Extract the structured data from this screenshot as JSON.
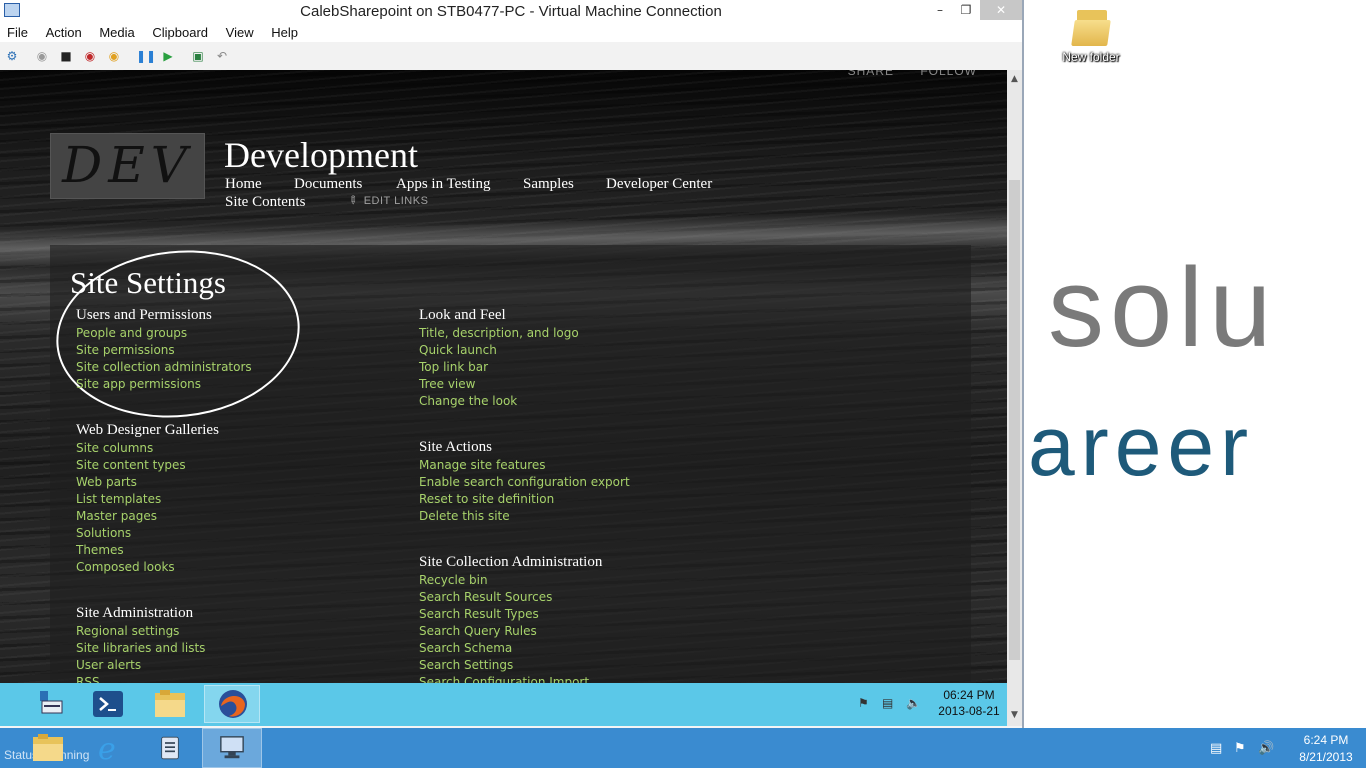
{
  "host": {
    "desktop_icon_label": "New folder",
    "background_word_1": "solu",
    "background_word_2": "areer",
    "status_text": "Status: Running",
    "clock_time": "6:24 PM",
    "clock_date": "8/21/2013",
    "taskbar_icons": [
      "file-explorer-icon",
      "internet-explorer-icon",
      "notepad-icon",
      "vm-connection-icon"
    ]
  },
  "vm_window": {
    "title": "CalebSharepoint on STB0477-PC - Virtual Machine Connection",
    "menu": [
      "File",
      "Action",
      "Media",
      "Clipboard",
      "View",
      "Help"
    ],
    "controls": {
      "minimize": "–",
      "maximize": "❐",
      "close": "✕"
    }
  },
  "sharepoint": {
    "top_actions": [
      "SHARE",
      "FOLLOW"
    ],
    "logo_text": "DEV",
    "site_title": "Development",
    "nav_row1": [
      "Home",
      "Documents",
      "Apps in Testing",
      "Samples",
      "Developer Center"
    ],
    "nav_row2": [
      "Site Contents"
    ],
    "edit_links": "EDIT LINKS",
    "page_title": "Site Settings",
    "groups": {
      "users_permissions": {
        "title": "Users and Permissions",
        "links": [
          "People and groups",
          "Site permissions",
          "Site collection administrators",
          "Site app permissions"
        ]
      },
      "web_designer": {
        "title": "Web Designer Galleries",
        "links": [
          "Site columns",
          "Site content types",
          "Web parts",
          "List templates",
          "Master pages",
          "Solutions",
          "Themes",
          "Composed looks"
        ]
      },
      "site_admin": {
        "title": "Site Administration",
        "links": [
          "Regional settings",
          "Site libraries and lists",
          "User alerts",
          "RSS"
        ]
      },
      "look_feel": {
        "title": "Look and Feel",
        "links": [
          "Title, description, and logo",
          "Quick launch",
          "Top link bar",
          "Tree view",
          "Change the look"
        ]
      },
      "site_actions": {
        "title": "Site Actions",
        "links": [
          "Manage site features",
          "Enable search configuration export",
          "Reset to site definition",
          "Delete this site"
        ]
      },
      "site_collection_admin": {
        "title": "Site Collection Administration",
        "links": [
          "Recycle bin",
          "Search Result Sources",
          "Search Result Types",
          "Search Query Rules",
          "Search Schema",
          "Search Settings",
          "Search Configuration Import"
        ]
      }
    }
  },
  "guest_taskbar": {
    "clock_time": "06:24 PM",
    "clock_date": "2013-08-21",
    "buttons": [
      "server-manager-icon",
      "powershell-icon",
      "file-explorer-icon",
      "firefox-icon"
    ]
  },
  "colors": {
    "link_green": "#a7d26b",
    "guest_taskbar": "#5bc8e8",
    "host_taskbar": "#3a8bd0"
  }
}
